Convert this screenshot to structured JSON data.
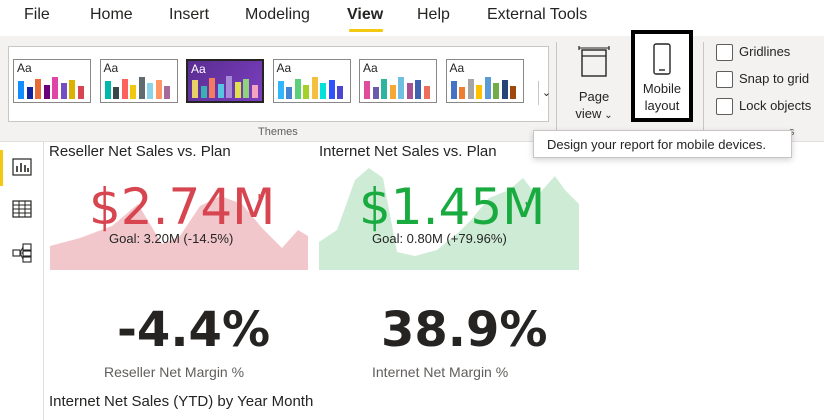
{
  "menu": {
    "items": [
      "File",
      "Home",
      "Insert",
      "Modeling",
      "View",
      "Help",
      "External Tools"
    ],
    "active": "View"
  },
  "ribbon": {
    "themes_label": "Themes",
    "themes": [
      {
        "selected": false,
        "bars": [
          "#118dff",
          "#12239e",
          "#e66c37",
          "#6b007b",
          "#e044a7",
          "#744ec2",
          "#d9b300",
          "#d64550"
        ]
      },
      {
        "selected": false,
        "bars": [
          "#01b8aa",
          "#374649",
          "#fd625e",
          "#f2c80f",
          "#5f6b6d",
          "#8ad4eb",
          "#fe9666",
          "#a66999"
        ]
      },
      {
        "selected": true,
        "bars": [
          "#e8d166",
          "#3ab0b2",
          "#f47a62",
          "#58c4e0",
          "#a88ad8",
          "#e0df4e",
          "#8fd37e",
          "#f4a3c0"
        ]
      },
      {
        "selected": false,
        "bars": [
          "#31b6fd",
          "#4584d3",
          "#5bd078",
          "#a5d028",
          "#f5c040",
          "#05e0db",
          "#3153fd",
          "#4c45d0"
        ]
      },
      {
        "selected": false,
        "bars": [
          "#e04b9c",
          "#6b5aab",
          "#2fb39d",
          "#f6a837",
          "#70bfe0",
          "#a85093",
          "#3e62ad",
          "#ed6e5a"
        ]
      },
      {
        "selected": false,
        "bars": [
          "#4472c4",
          "#ed7d31",
          "#a5a5a5",
          "#ffc000",
          "#5b9bd5",
          "#70ad47",
          "#264478",
          "#9e480e"
        ]
      }
    ],
    "theme_glyph": "Aa",
    "page_view_label": "Page view",
    "mobile_label": "Mobile layout",
    "checks": [
      {
        "label": "Gridlines",
        "checked": false
      },
      {
        "label": "Snap to grid",
        "checked": false
      },
      {
        "label": "Lock objects",
        "checked": false
      }
    ],
    "show_panes_label_fragment": "s"
  },
  "tooltip": "Design your report for mobile devices.",
  "rail": {
    "icons": [
      "report-view-icon",
      "data-view-icon",
      "model-view-icon"
    ],
    "active": "report-view-icon"
  },
  "cards": {
    "reseller": {
      "title": "Reseller Net Sales vs. Plan",
      "value": "$2.74M",
      "indicator": "!",
      "goal": "Goal: 3.20M (-14.5%)",
      "color": "#d64550",
      "trend_color": "#f2c7cb"
    },
    "internet": {
      "title": "Internet Net Sales vs. Plan",
      "value": "$1.45M",
      "indicator": "✓",
      "goal": "Goal: 0.80M (+79.96%)",
      "color": "#1aab40",
      "trend_color": "#cdebd5"
    },
    "reseller_margin": {
      "value": "-4.4%",
      "label": "Reseller Net Margin %"
    },
    "internet_margin": {
      "value": "38.9%",
      "label": "Internet Net Margin %"
    },
    "ytd_title": "Internet Net Sales (YTD) by Year Month"
  }
}
